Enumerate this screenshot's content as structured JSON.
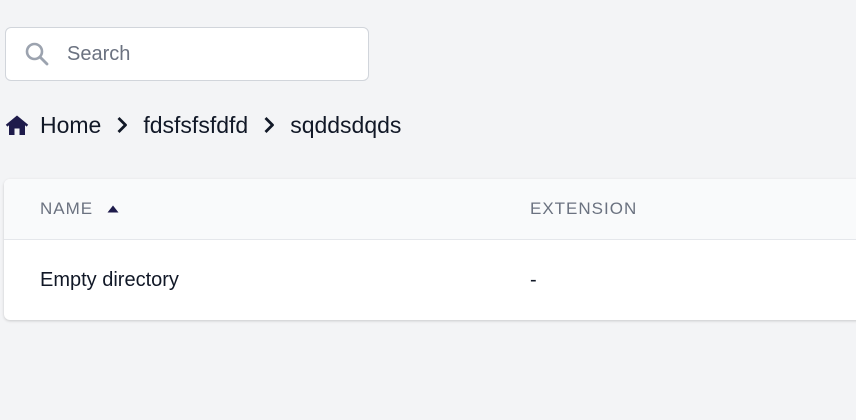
{
  "search": {
    "placeholder": "Search",
    "value": ""
  },
  "breadcrumb": {
    "items": [
      {
        "label": "Home"
      },
      {
        "label": "fdsfsfsfdfd"
      },
      {
        "label": "sqddsdqds"
      }
    ]
  },
  "table": {
    "columns": [
      {
        "label": "Name",
        "sort": "ascending"
      },
      {
        "label": "Extension"
      }
    ],
    "rows": [
      {
        "name": "Empty directory",
        "extension": "-"
      }
    ]
  },
  "colors": {
    "accent": "#1e1b4b",
    "page_background": "#f3f4f6",
    "header_background": "#f9fafb"
  },
  "icons": {
    "search": "search-icon",
    "home": "home-icon",
    "separator": "chevron-right-icon",
    "sort": "sort-ascending-icon"
  }
}
